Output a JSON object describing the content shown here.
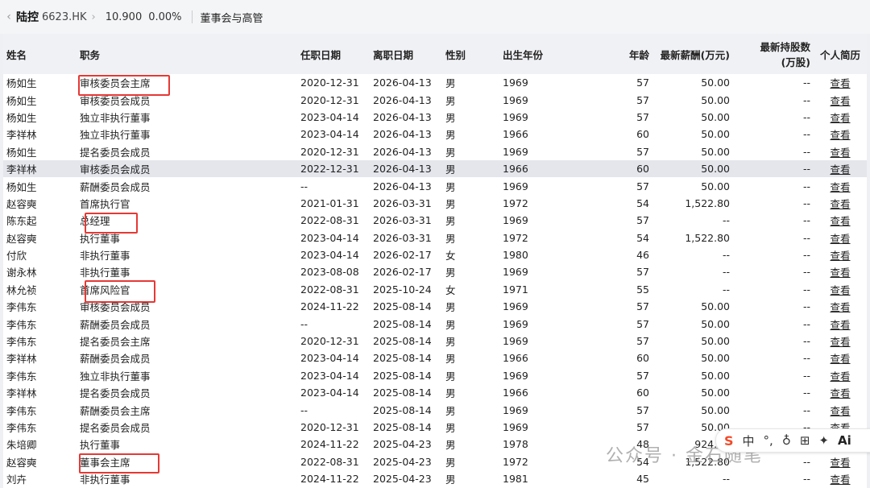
{
  "header": {
    "back_glyph": "‹",
    "stock_name": "陆控",
    "stock_code": "6623.HK",
    "chevron": "›",
    "price": "10.900",
    "change_pct": "0.00%",
    "section_title": "董事会与高管"
  },
  "table": {
    "columns": [
      "姓名",
      "职务",
      "任职日期",
      "离职日期",
      "性别",
      "出生年份",
      "年龄",
      "最新薪酬(万元)",
      "最新持股数",
      "(万股)",
      "个人简历"
    ],
    "rows": [
      {
        "name": "杨如生",
        "position": "审核委员会主席",
        "start": "2020-12-31",
        "end": "2026-04-13",
        "gender": "男",
        "birth": "1969",
        "age": "57",
        "salary": "50.00",
        "shares": "--",
        "resume": "查看"
      },
      {
        "name": "杨如生",
        "position": "审核委员会成员",
        "start": "2020-12-31",
        "end": "2026-04-13",
        "gender": "男",
        "birth": "1969",
        "age": "57",
        "salary": "50.00",
        "shares": "--",
        "resume": "查看"
      },
      {
        "name": "杨如生",
        "position": "独立非执行董事",
        "start": "2023-04-14",
        "end": "2026-04-13",
        "gender": "男",
        "birth": "1969",
        "age": "57",
        "salary": "50.00",
        "shares": "--",
        "resume": "查看"
      },
      {
        "name": "李祥林",
        "position": "独立非执行董事",
        "start": "2023-04-14",
        "end": "2026-04-13",
        "gender": "男",
        "birth": "1966",
        "age": "60",
        "salary": "50.00",
        "shares": "--",
        "resume": "查看"
      },
      {
        "name": "杨如生",
        "position": "提名委员会成员",
        "start": "2020-12-31",
        "end": "2026-04-13",
        "gender": "男",
        "birth": "1969",
        "age": "57",
        "salary": "50.00",
        "shares": "--",
        "resume": "查看"
      },
      {
        "name": "李祥林",
        "position": "审核委员会成员",
        "start": "2022-12-31",
        "end": "2026-04-13",
        "gender": "男",
        "birth": "1966",
        "age": "60",
        "salary": "50.00",
        "shares": "--",
        "resume": "查看"
      },
      {
        "name": "杨如生",
        "position": "薪酬委员会成员",
        "start": "--",
        "end": "2026-04-13",
        "gender": "男",
        "birth": "1969",
        "age": "57",
        "salary": "50.00",
        "shares": "--",
        "resume": "查看"
      },
      {
        "name": "赵容奭",
        "position": "首席执行官",
        "start": "2021-01-31",
        "end": "2026-03-31",
        "gender": "男",
        "birth": "1972",
        "age": "54",
        "salary": "1,522.80",
        "shares": "--",
        "resume": "查看"
      },
      {
        "name": "陈东起",
        "position": "总经理",
        "start": "2022-08-31",
        "end": "2026-03-31",
        "gender": "男",
        "birth": "1969",
        "age": "57",
        "salary": "--",
        "shares": "--",
        "resume": "查看"
      },
      {
        "name": "赵容奭",
        "position": "执行董事",
        "start": "2023-04-14",
        "end": "2026-03-31",
        "gender": "男",
        "birth": "1972",
        "age": "54",
        "salary": "1,522.80",
        "shares": "--",
        "resume": "查看"
      },
      {
        "name": "付欣",
        "position": "非执行董事",
        "start": "2023-04-14",
        "end": "2026-02-17",
        "gender": "女",
        "birth": "1980",
        "age": "46",
        "salary": "--",
        "shares": "--",
        "resume": "查看"
      },
      {
        "name": "谢永林",
        "position": "非执行董事",
        "start": "2023-08-08",
        "end": "2026-02-17",
        "gender": "男",
        "birth": "1969",
        "age": "57",
        "salary": "--",
        "shares": "--",
        "resume": "查看"
      },
      {
        "name": "林允祯",
        "position": "首席风险官",
        "start": "2022-08-31",
        "end": "2025-10-24",
        "gender": "女",
        "birth": "1971",
        "age": "55",
        "salary": "--",
        "shares": "--",
        "resume": "查看"
      },
      {
        "name": "李伟东",
        "position": "审核委员会成员",
        "start": "2024-11-22",
        "end": "2025-08-14",
        "gender": "男",
        "birth": "1969",
        "age": "57",
        "salary": "50.00",
        "shares": "--",
        "resume": "查看"
      },
      {
        "name": "李伟东",
        "position": "薪酬委员会成员",
        "start": "--",
        "end": "2025-08-14",
        "gender": "男",
        "birth": "1969",
        "age": "57",
        "salary": "50.00",
        "shares": "--",
        "resume": "查看"
      },
      {
        "name": "李伟东",
        "position": "提名委员会主席",
        "start": "2020-12-31",
        "end": "2025-08-14",
        "gender": "男",
        "birth": "1969",
        "age": "57",
        "salary": "50.00",
        "shares": "--",
        "resume": "查看"
      },
      {
        "name": "李祥林",
        "position": "薪酬委员会成员",
        "start": "2023-04-14",
        "end": "2025-08-14",
        "gender": "男",
        "birth": "1966",
        "age": "60",
        "salary": "50.00",
        "shares": "--",
        "resume": "查看"
      },
      {
        "name": "李伟东",
        "position": "独立非执行董事",
        "start": "2023-04-14",
        "end": "2025-08-14",
        "gender": "男",
        "birth": "1969",
        "age": "57",
        "salary": "50.00",
        "shares": "--",
        "resume": "查看"
      },
      {
        "name": "李祥林",
        "position": "提名委员会成员",
        "start": "2023-04-14",
        "end": "2025-08-14",
        "gender": "男",
        "birth": "1966",
        "age": "60",
        "salary": "50.00",
        "shares": "--",
        "resume": "查看"
      },
      {
        "name": "李伟东",
        "position": "薪酬委员会主席",
        "start": "--",
        "end": "2025-08-14",
        "gender": "男",
        "birth": "1969",
        "age": "57",
        "salary": "50.00",
        "shares": "--",
        "resume": "查看"
      },
      {
        "name": "李伟东",
        "position": "提名委员会成员",
        "start": "2020-12-31",
        "end": "2025-08-14",
        "gender": "男",
        "birth": "1969",
        "age": "57",
        "salary": "50.00",
        "shares": "--",
        "resume": "查看"
      },
      {
        "name": "朱培卿",
        "position": "执行董事",
        "start": "2024-11-22",
        "end": "2025-04-23",
        "gender": "男",
        "birth": "1978",
        "age": "48",
        "salary": "924.70",
        "shares": "--",
        "resume": "查看"
      },
      {
        "name": "赵容奭",
        "position": "董事会主席",
        "start": "2022-08-31",
        "end": "2025-04-23",
        "gender": "男",
        "birth": "1972",
        "age": "54",
        "salary": "1,522.80",
        "shares": "--",
        "resume": "查看"
      },
      {
        "name": "刘卉",
        "position": "非执行董事",
        "start": "2024-11-22",
        "end": "2025-04-23",
        "gender": "男",
        "birth": "1981",
        "age": "45",
        "salary": "--",
        "shares": "--",
        "resume": "查看"
      }
    ]
  },
  "watermark": {
    "text": "公众号 · 金石随笔"
  },
  "input_toolbar": {
    "logo": "S",
    "lang": "中",
    "punct": "°,",
    "mic": "♁",
    "keyboard": "⊞",
    "skin": "✦",
    "ai": "Ai"
  }
}
